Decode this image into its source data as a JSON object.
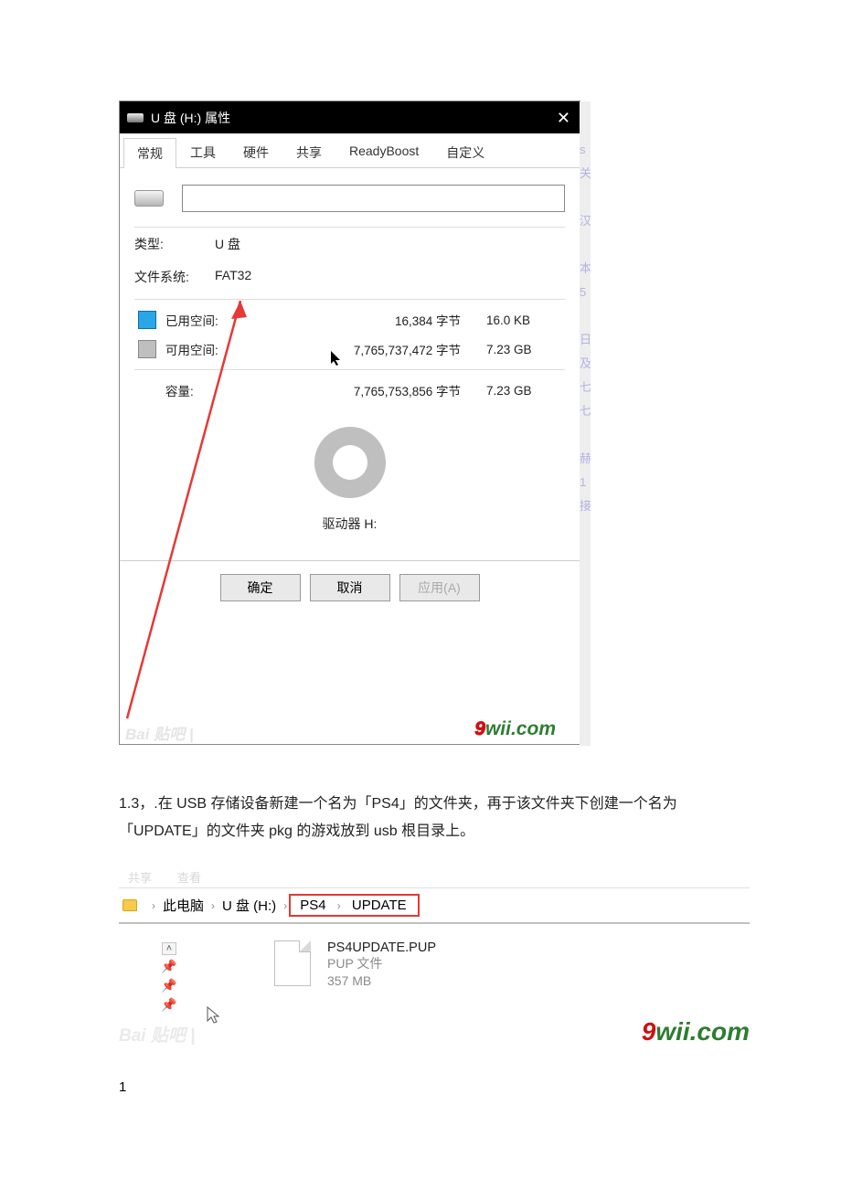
{
  "dialog": {
    "title": "U 盘 (H:) 属性",
    "tabs": [
      "常规",
      "工具",
      "硬件",
      "共享",
      "ReadyBoost",
      "自定义"
    ],
    "labels": {
      "type": "类型:",
      "filesystem": "文件系统:",
      "used": "已用空间:",
      "free": "可用空间:",
      "capacity": "容量:",
      "drive": "驱动器 H:"
    },
    "values": {
      "type": "U 盘",
      "filesystem": "FAT32",
      "used_bytes": "16,384 字节",
      "used_human": "16.0 KB",
      "free_bytes": "7,765,737,472 字节",
      "free_human": "7.23 GB",
      "cap_bytes": "7,765,753,856 字节",
      "cap_human": "7.23 GB"
    },
    "buttons": {
      "ok": "确定",
      "cancel": "取消",
      "apply": "应用(A)"
    },
    "watermark_a": "Bai 贴吧 |",
    "watermark_b_9": "9",
    "watermark_b_rest": "wii.com"
  },
  "paragraph": "1.3，.在 USB 存储设备新建一个名为「PS4」的文件夹，再于该文件夹下创建一个名为「UPDATE」的文件夹 pkg 的游戏放到 usb 根目录上。",
  "explorer": {
    "menu": [
      "共享",
      "查看"
    ],
    "crumbs": [
      "此电脑",
      "U 盘 (H:)",
      "PS4",
      "UPDATE"
    ],
    "file": {
      "name": "PS4UPDATE.PUP",
      "type_line": "PUP 文件",
      "size_line": "357 MB"
    },
    "watermark_a": "Bai 贴吧 |"
  },
  "footnote": "1"
}
